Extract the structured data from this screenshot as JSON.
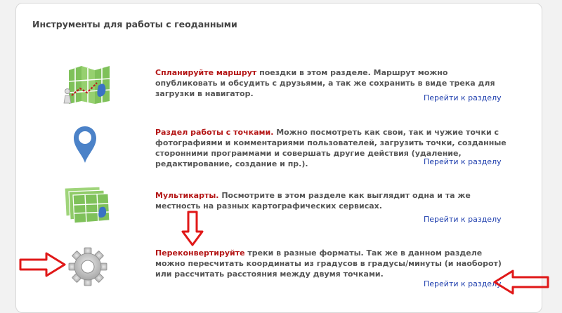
{
  "panel": {
    "title": "Инструменты для работы с геоданными"
  },
  "sections": [
    {
      "lead": "Спланируйте маршрут",
      "text": " поездки в этом разделе. Маршрут можно опубликовать и обсудить с друзьями, а так же сохранить в виде трека для загрузки в навигатор.",
      "link": "Перейти к разделу",
      "icon": "route-map-icon"
    },
    {
      "lead": "Раздел работы с точками.",
      "text": " Можно посмотреть как свои, так и чужие точки с фотографиями и комментариями пользователей, загрузить точки, созданные сторонними программами и совершать другие действия (удаление, редактирование, создание и пр.).",
      "link": "Перейти к разделу",
      "icon": "map-pin-icon"
    },
    {
      "lead": "Мультикарты.",
      "text": " Посмотрите в этом разделе как выглядит одна и та же местность на разных картографических сервисах.",
      "link": "Перейти к разделу",
      "icon": "multimap-icon"
    },
    {
      "lead": "Переконвертируйте",
      "text": " треки в разные форматы. Так же в данном разделе можно пересчитать координаты из градусов в градусы/минуты (и наоборот) или рассчитать расстояния между двумя точками.",
      "link": "Перейти к разделу",
      "icon": "gear-icon"
    }
  ],
  "colors": {
    "lead": "#b41616",
    "link": "#1f3fae",
    "annotation_arrow": "#e01818"
  }
}
